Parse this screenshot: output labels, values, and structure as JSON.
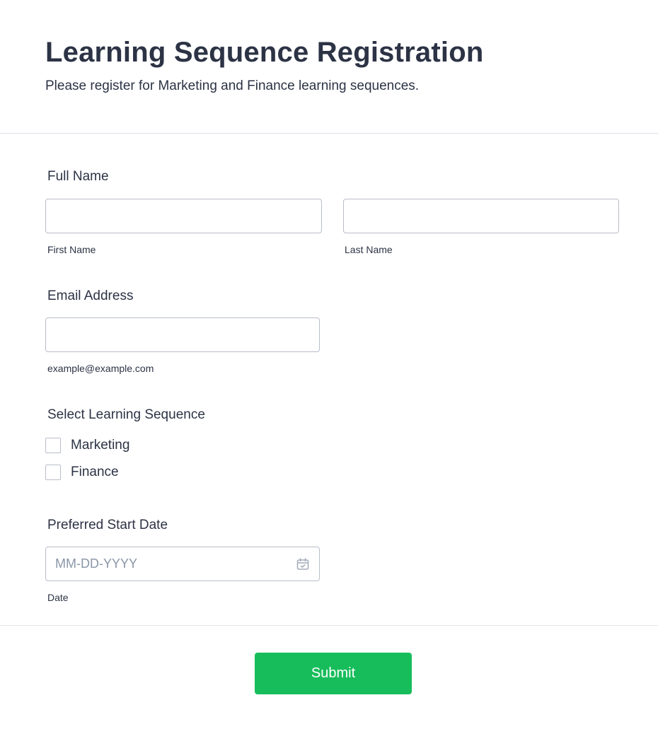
{
  "header": {
    "title": "Learning Sequence Registration",
    "subtitle": "Please register for Marketing and Finance learning sequences."
  },
  "full_name": {
    "label": "Full Name",
    "first_value": "",
    "first_sublabel": "First Name",
    "last_value": "",
    "last_sublabel": "Last Name"
  },
  "email": {
    "label": "Email Address",
    "value": "",
    "sublabel": "example@example.com"
  },
  "sequence": {
    "label": "Select Learning Sequence",
    "options": [
      {
        "label": "Marketing",
        "checked": false
      },
      {
        "label": "Finance",
        "checked": false
      }
    ]
  },
  "start_date": {
    "label": "Preferred Start Date",
    "placeholder": "MM-DD-YYYY",
    "value": "",
    "sublabel": "Date",
    "icon": "calendar-icon"
  },
  "submit": {
    "label": "Submit",
    "color": "#18bd5b"
  }
}
